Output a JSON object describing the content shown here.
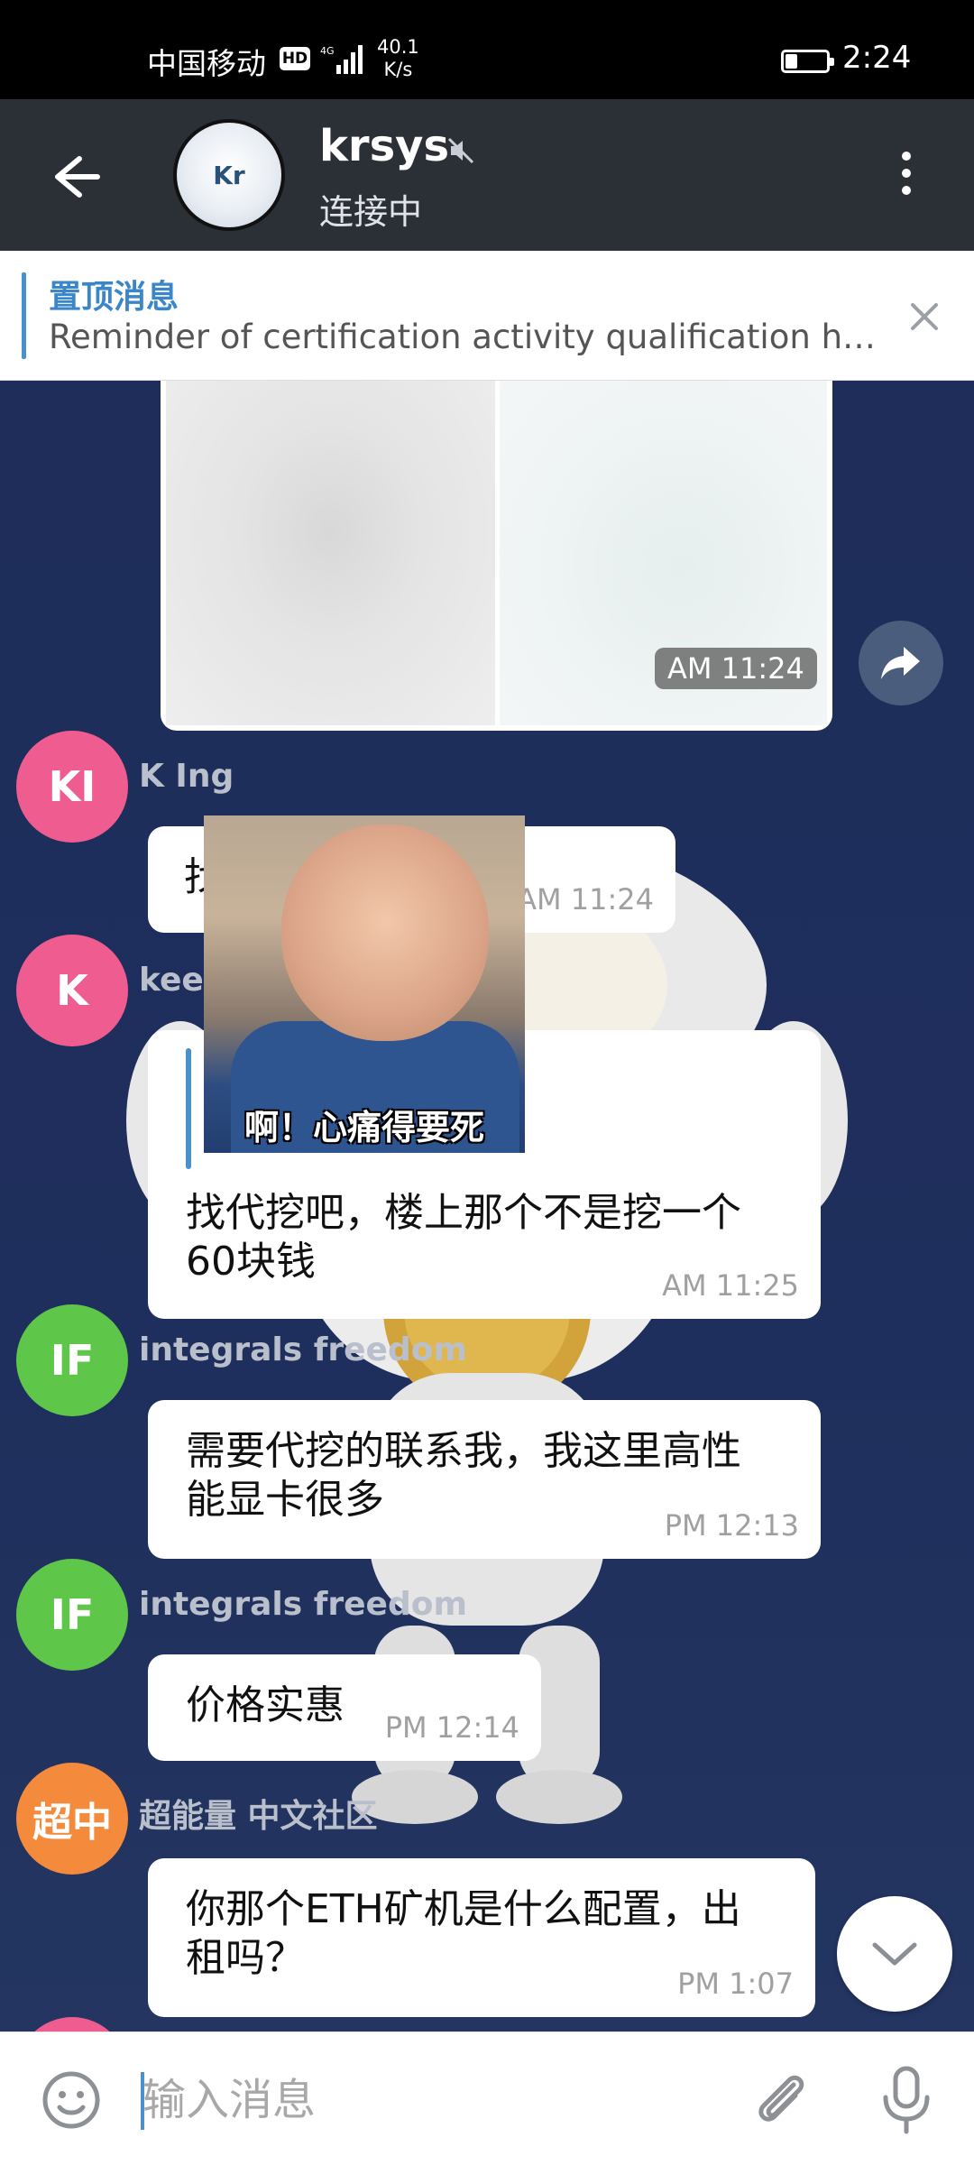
{
  "status_bar": {
    "carrier": "中国移动",
    "hd_badge": "HD",
    "network": "4G",
    "speed_value": "40.1",
    "speed_unit": "K/s",
    "battery_level": 0.3,
    "time": "2:24"
  },
  "header": {
    "avatar_text": "Kr",
    "title": "krsys",
    "subtitle": "连接中"
  },
  "pinned": {
    "title": "置顶消息",
    "text": "Reminder of certification activity qualification h…"
  },
  "photo_message": {
    "time": "AM 11:24"
  },
  "messages": [
    {
      "avatar": "KI",
      "avatar_color": "#ef5c8f",
      "sender": "K Ing",
      "text": "找",
      "time": "AM 11:24"
    },
    {
      "avatar": "K",
      "avatar_color": "#ef5c8f",
      "sender": "keep",
      "sticker_caption": "啊！心痛得要死",
      "text_line1": "找代挖吧，楼上那个不是挖一个",
      "text_line2": "60块钱",
      "time": "AM 11:25"
    },
    {
      "avatar": "IF",
      "avatar_color": "#5ec648",
      "sender": "integrals freedom",
      "text_line1": "需要代挖的联系我，我这里高性",
      "text_line2": "能显卡很多",
      "time": "PM 12:13"
    },
    {
      "avatar": "IF",
      "avatar_color": "#5ec648",
      "sender": "integrals freedom",
      "text": "价格实惠",
      "time": "PM 12:14"
    },
    {
      "avatar": "超中",
      "avatar_color": "#f48a3c",
      "sender": "超能量 中文社区",
      "text_line1": "你那个ETH矿机是什么配置，出",
      "text_line2": "租吗？",
      "time": "PM 1:07"
    }
  ],
  "input": {
    "placeholder": "输入消息"
  },
  "colors": {
    "header_bg": "#2b2f36",
    "chat_bg": "#1f2d58",
    "accent": "#3a86c8"
  }
}
